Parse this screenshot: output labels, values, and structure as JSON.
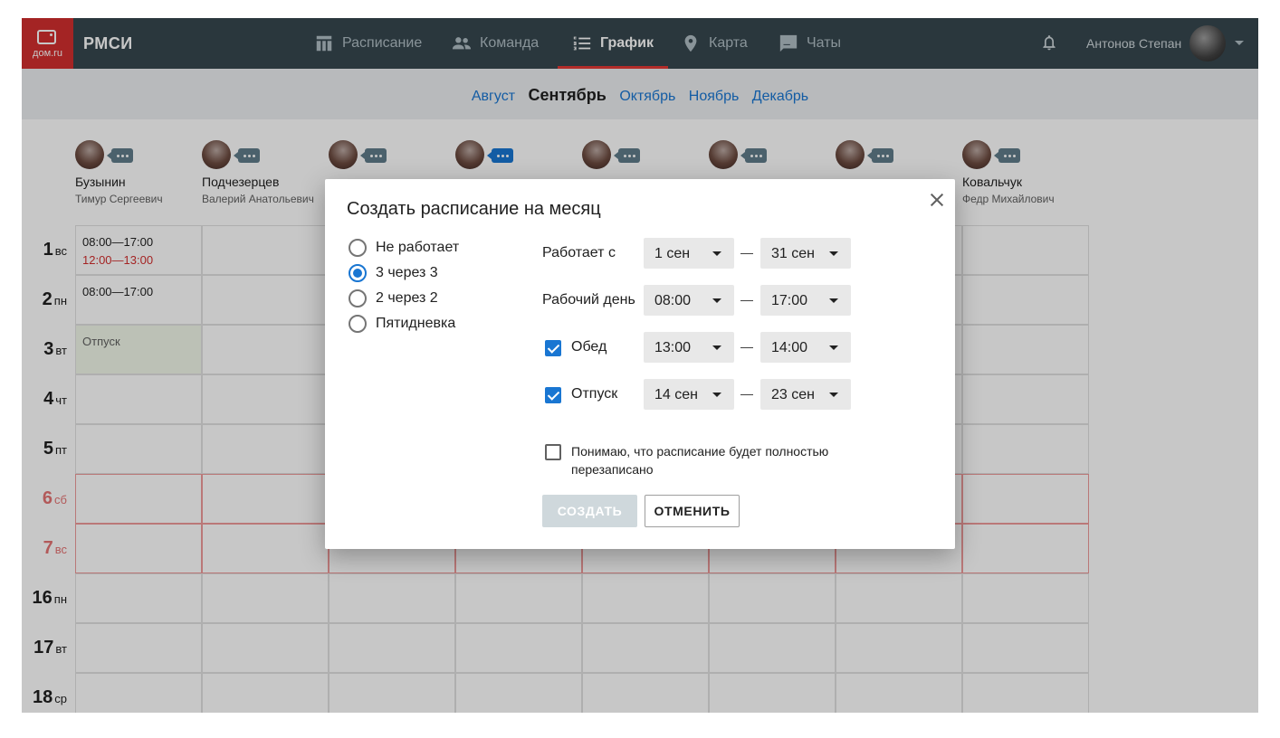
{
  "header": {
    "logo_text": "дом.ru",
    "app_title": "РМСИ",
    "nav": [
      {
        "label": "Расписание",
        "icon": "table-icon"
      },
      {
        "label": "Команда",
        "icon": "people-icon"
      },
      {
        "label": "График",
        "icon": "list-icon",
        "active": true
      },
      {
        "label": "Карта",
        "icon": "map-pin-icon"
      },
      {
        "label": "Чаты",
        "icon": "chat-icon"
      }
    ],
    "user_name": "Антонов Степан",
    "accent_color": "#e53935"
  },
  "months": {
    "items": [
      "Август",
      "Сентябрь",
      "Октябрь",
      "Ноябрь",
      "Декабрь"
    ],
    "current": "Сентябрь"
  },
  "employees": [
    {
      "surname": "Бузынин",
      "patronymic": "Тимур Сергеевич"
    },
    {
      "surname": "Подчезерцев",
      "patronymic": "Валерий Анатольевич"
    },
    {
      "surname": "",
      "patronymic": ""
    },
    {
      "surname": "",
      "patronymic": ""
    },
    {
      "surname": "",
      "patronymic": ""
    },
    {
      "surname": "",
      "patronymic": ""
    },
    {
      "surname": "",
      "patronymic": ""
    },
    {
      "surname": "Ковальчук",
      "patronymic": "Федр Михайлович"
    }
  ],
  "days": [
    {
      "num": "1",
      "dow": "вс",
      "weekend": false
    },
    {
      "num": "2",
      "dow": "пн",
      "weekend": false
    },
    {
      "num": "3",
      "dow": "вт",
      "weekend": false
    },
    {
      "num": "4",
      "dow": "чт",
      "weekend": false
    },
    {
      "num": "5",
      "dow": "пт",
      "weekend": false
    },
    {
      "num": "6",
      "dow": "сб",
      "weekend": true
    },
    {
      "num": "7",
      "dow": "вс",
      "weekend": true
    },
    {
      "num": "16",
      "dow": "пн",
      "weekend": false
    },
    {
      "num": "17",
      "dow": "вт",
      "weekend": false
    },
    {
      "num": "18",
      "dow": "ср",
      "weekend": false
    }
  ],
  "cells": {
    "day1_work": "08:00—17:00",
    "day1_lunch": "12:00—13:00",
    "day2_work": "08:00—17:00",
    "day3_vacation": "Отпуск"
  },
  "modal": {
    "title": "Создать расписание на месяц",
    "modes": [
      {
        "label": "Не работает",
        "checked": false
      },
      {
        "label": "3 через 3",
        "checked": true
      },
      {
        "label": "2 через 2",
        "checked": false
      },
      {
        "label": "Пятидневка",
        "checked": false
      }
    ],
    "works_from": {
      "label": "Работает с",
      "from": "1 сен",
      "to": "31 сен"
    },
    "workday": {
      "label": "Рабочий день",
      "from": "08:00",
      "to": "17:00"
    },
    "lunch": {
      "label": "Обед",
      "checked": true,
      "from": "13:00",
      "to": "14:00"
    },
    "vacation": {
      "label": "Отпуск",
      "checked": true,
      "from": "14 сен",
      "to": "23 сен"
    },
    "consent": {
      "label": "Понимаю, что расписание будет полностью перезаписано",
      "checked": false
    },
    "create_label": "СОЗДАТЬ",
    "cancel_label": "ОТМЕНИТЬ"
  }
}
